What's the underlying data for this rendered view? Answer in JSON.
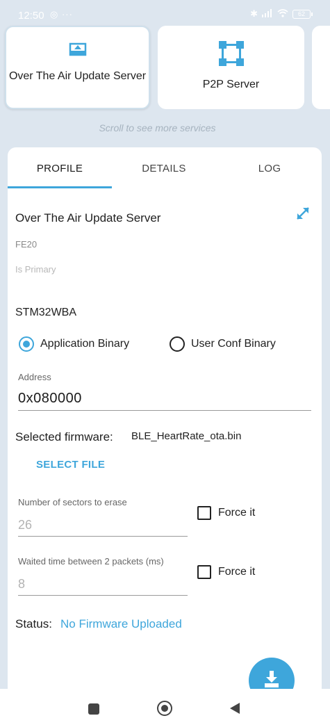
{
  "status_bar": {
    "time": "12:50",
    "left_icons": "◎ ···",
    "battery": "62"
  },
  "services": {
    "cards": [
      {
        "label": "Over The Air Update Server",
        "icon": "upload-tray-icon"
      },
      {
        "label": "P2P Server",
        "icon": "p2p-nodes-icon"
      }
    ],
    "scroll_hint": "Scroll to see more services"
  },
  "tabs": [
    {
      "label": "PROFILE",
      "selected": true
    },
    {
      "label": "DETAILS",
      "selected": false
    },
    {
      "label": "LOG",
      "selected": false
    }
  ],
  "profile": {
    "service_title": "Over The Air Update Server",
    "uuid": "FE20",
    "primary_label": "Is Primary",
    "board": "STM32WBA",
    "binary_options": [
      {
        "label": "Application Binary",
        "selected": true
      },
      {
        "label": "User Conf Binary",
        "selected": false
      }
    ],
    "address_label": "Address",
    "address_value": "0x080000",
    "firmware_label": "Selected firmware:",
    "firmware_name": "BLE_HeartRate_ota.bin",
    "select_file_label": "SELECT FILE",
    "sectors_label": "Number of sectors to erase",
    "sectors_value": "26",
    "sectors_force_label": "Force it",
    "wait_label": "Waited time between 2 packets (ms)",
    "wait_value": "8",
    "wait_force_label": "Force it",
    "status_label": "Status:",
    "status_value": "No Firmware Uploaded"
  },
  "colors": {
    "accent": "#3ea6db",
    "background": "#dde6ef"
  }
}
